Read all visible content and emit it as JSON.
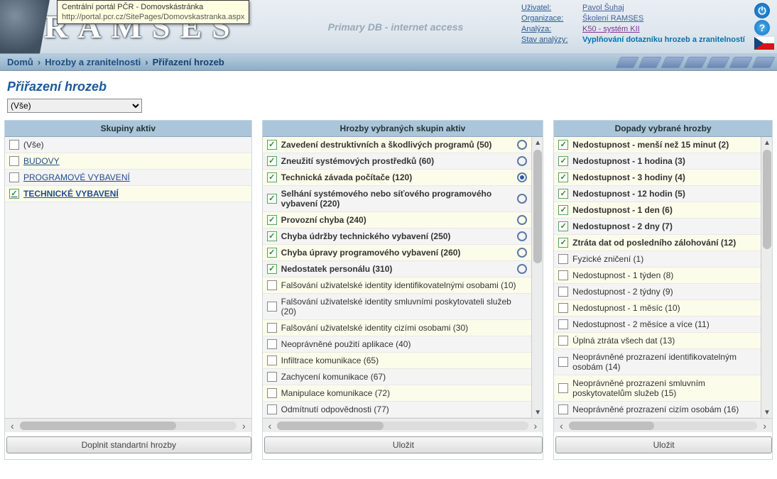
{
  "tooltip": {
    "title": "Centrální portál PČR - Domovskástránka",
    "url": "http://portal.pcr.cz/SitePages/Domovskastranka.aspx"
  },
  "logo": "RAMSES",
  "center": "Primary DB - internet access",
  "info": {
    "user_label": "Uživatel:",
    "user_val": "Pavol Šuhaj",
    "org_label": "Organizace:",
    "org_val": "Školení RAMSES",
    "an_label": "Analýza:",
    "an_val": "K50 - systém KII",
    "stav_label": "Stav analýzy:",
    "stav_val": "Vyplňování dotazníku hrozeb a zranitelností"
  },
  "breadcrumb": {
    "home": "Domů",
    "mid": "Hrozby a zranitelnosti",
    "current": "Přiřazení hrozeb"
  },
  "page_title": "Přiřazení hrozeb",
  "filter": {
    "selected": "(Vše)"
  },
  "columns": {
    "c1": "Skupiny aktiv",
    "c2": "Hrozby vybraných skupin aktiv",
    "c3": "Dopady vybrané hrozby"
  },
  "groups": [
    {
      "label": "(Vše)",
      "checked": false,
      "link": false,
      "bold": false
    },
    {
      "label": "BUDOVY",
      "checked": false,
      "link": true,
      "bold": false
    },
    {
      "label": "PROGRAMOVÉ VYBAVENÍ",
      "checked": false,
      "link": true,
      "bold": false
    },
    {
      "label": "TECHNICKÉ VYBAVENÍ",
      "checked": true,
      "link": true,
      "bold": true
    }
  ],
  "threats": [
    {
      "label": "Zavedení destruktivních a škodlivých programů (50)",
      "checked": true,
      "bold": true,
      "radio": "off"
    },
    {
      "label": "Zneužití systémových prostředků (60)",
      "checked": true,
      "bold": true,
      "radio": "off"
    },
    {
      "label": "Technická závada počítače (120)",
      "checked": true,
      "bold": true,
      "radio": "on"
    },
    {
      "label": "Selhání systémového nebo síťového programového vybavení (220)",
      "checked": true,
      "bold": true,
      "radio": "off"
    },
    {
      "label": "Provozní chyba (240)",
      "checked": true,
      "bold": true,
      "radio": "off"
    },
    {
      "label": "Chyba údržby technického vybavení (250)",
      "checked": true,
      "bold": true,
      "radio": "off"
    },
    {
      "label": "Chyba úpravy programového vybavení (260)",
      "checked": true,
      "bold": true,
      "radio": "off"
    },
    {
      "label": "Nedostatek personálu (310)",
      "checked": true,
      "bold": true,
      "radio": "off"
    },
    {
      "label": "Falšování uživatelské identity identifikovatelnými osobami (10)",
      "checked": false,
      "bold": false
    },
    {
      "label": "Falšování uživatelské identity smluvními poskytovateli služeb (20)",
      "checked": false,
      "bold": false
    },
    {
      "label": "Falšování uživatelské identity cizími osobami (30)",
      "checked": false,
      "bold": false
    },
    {
      "label": "Neoprávněné použití aplikace (40)",
      "checked": false,
      "bold": false
    },
    {
      "label": "Infiltrace komunikace (65)",
      "checked": false,
      "bold": false
    },
    {
      "label": "Zachycení komunikace (67)",
      "checked": false,
      "bold": false
    },
    {
      "label": "Manipulace komunikace (72)",
      "checked": false,
      "bold": false
    },
    {
      "label": "Odmítnutí odpovědnosti (77)",
      "checked": false,
      "bold": false
    }
  ],
  "impacts": [
    {
      "label": "Nedostupnost - menší než 15 minut (2)",
      "checked": true,
      "bold": true
    },
    {
      "label": "Nedostupnost - 1 hodina (3)",
      "checked": true,
      "bold": true
    },
    {
      "label": "Nedostupnost - 3 hodiny (4)",
      "checked": true,
      "bold": true
    },
    {
      "label": "Nedostupnost - 12 hodin (5)",
      "checked": true,
      "bold": true
    },
    {
      "label": "Nedostupnost - 1 den (6)",
      "checked": true,
      "bold": true
    },
    {
      "label": "Nedostupnost - 2 dny (7)",
      "checked": true,
      "bold": true
    },
    {
      "label": "Ztráta dat od posledního zálohování (12)",
      "checked": true,
      "bold": true
    },
    {
      "label": "Fyzické zničení (1)",
      "checked": false,
      "bold": false
    },
    {
      "label": "Nedostupnost - 1 týden (8)",
      "checked": false,
      "bold": false
    },
    {
      "label": "Nedostupnost - 2 týdny (9)",
      "checked": false,
      "bold": false
    },
    {
      "label": "Nedostupnost - 1 měsíc (10)",
      "checked": false,
      "bold": false
    },
    {
      "label": "Nedostupnost - 2 měsíce a více (11)",
      "checked": false,
      "bold": false
    },
    {
      "label": "Úplná ztráta všech dat (13)",
      "checked": false,
      "bold": false
    },
    {
      "label": "Neoprávněné prozrazení identifikovatelným osobám (14)",
      "checked": false,
      "bold": false
    },
    {
      "label": "Neoprávněné prozrazení smluvním poskytovatelům služeb (15)",
      "checked": false,
      "bold": false
    },
    {
      "label": "Neoprávněné prozrazení cizím osobám (16)",
      "checked": false,
      "bold": false
    }
  ],
  "buttons": {
    "default_threats": "Doplnit standartní hrozby",
    "save": "Uložit"
  }
}
